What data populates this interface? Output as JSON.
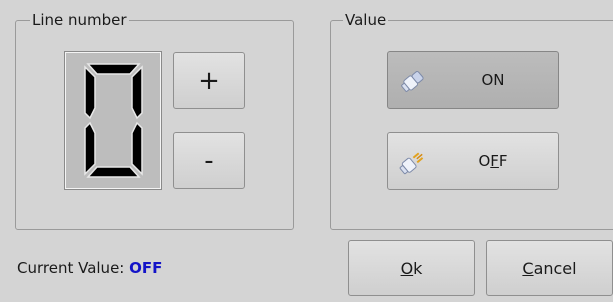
{
  "line_group": {
    "title": "Line number",
    "digit": "0",
    "plus_label": "+",
    "minus_label": "-"
  },
  "value_group": {
    "title": "Value",
    "on_label": "ON",
    "on_icon": "plug-connected-icon",
    "off_label_prefix": "O",
    "off_label_mnemonic": "F",
    "off_label_suffix": "F",
    "off_icon": "plug-disconnected-icon"
  },
  "status": {
    "current_label": "Current Value:",
    "current_value": "OFF",
    "current_value_color": "#1414c8"
  },
  "dialog_buttons": {
    "ok_mnemonic": "O",
    "ok_rest": "k",
    "cancel_mnemonic": "C",
    "cancel_rest": "ancel"
  }
}
